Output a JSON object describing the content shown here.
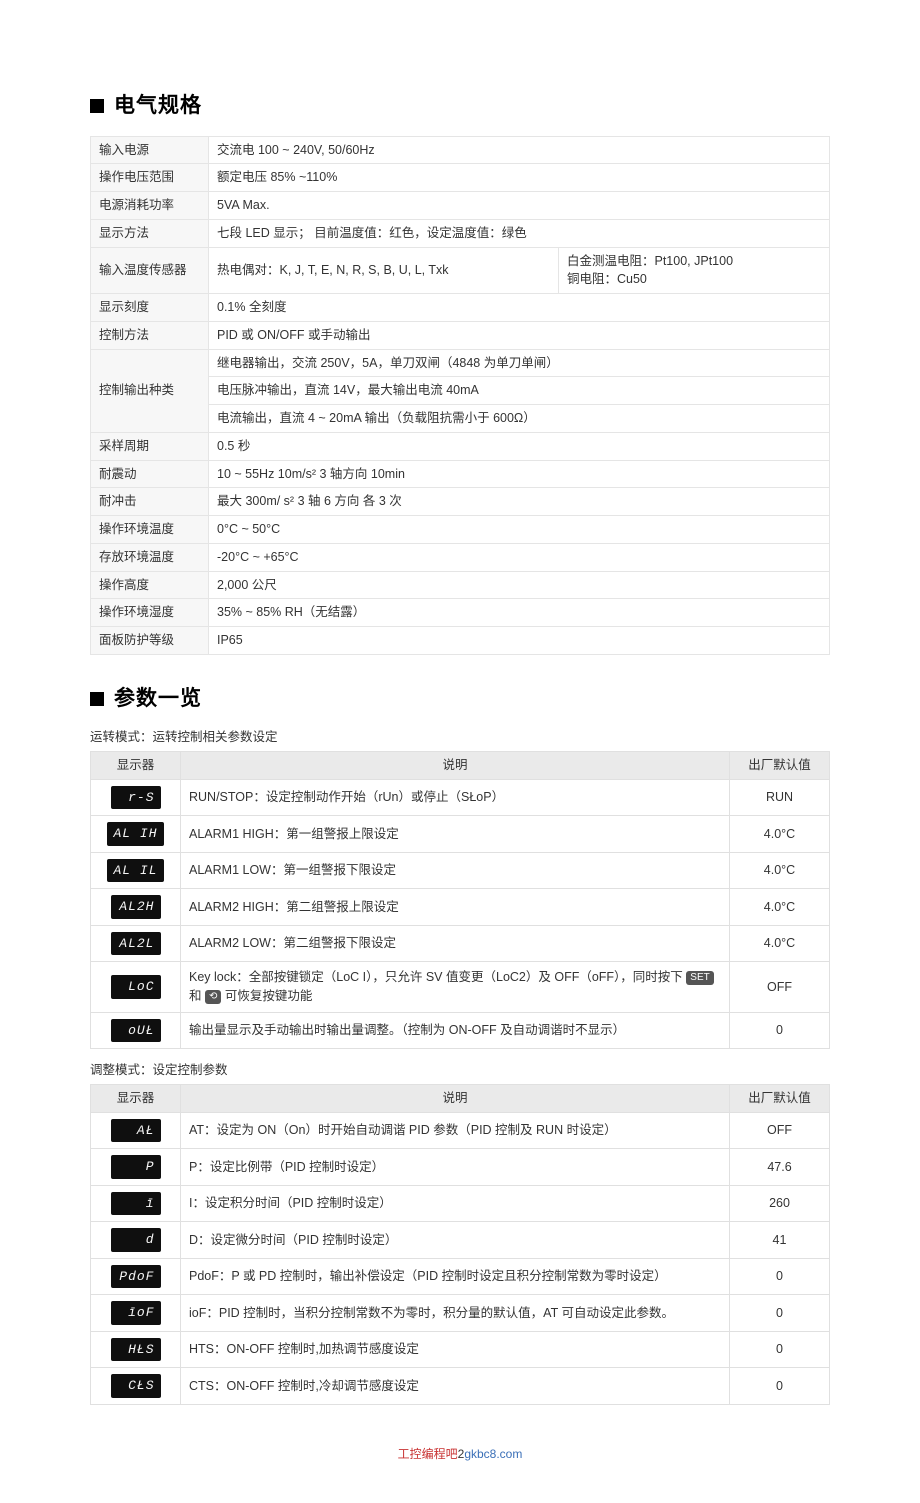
{
  "sections": {
    "electrical": "电气规格",
    "params": "参数一览"
  },
  "spec": {
    "power_supply_label": "输入电源",
    "power_supply": "交流电 100 ~ 240V, 50/60Hz",
    "op_voltage_label": "操作电压范围",
    "op_voltage": "额定电压 85% ~110%",
    "consumption_label": "电源消耗功率",
    "consumption": "5VA Max.",
    "display_method_label": "显示方法",
    "display_method": "七段 LED 显示；  目前温度值：红色，设定温度值：绿色",
    "input_sensor_label": "输入温度传感器",
    "input_sensor_left": "热电偶对：K, J, T, E, N, R, S, B, U, L, Txk",
    "input_sensor_right_a": "白金测温电阻：Pt100, JPt100",
    "input_sensor_right_b": "铜电阻：Cu50",
    "display_scale_label": "显示刻度",
    "display_scale": "0.1%  全刻度",
    "control_method_label": "控制方法",
    "control_method": "PID 或 ON/OFF 或手动输出",
    "ctrl_output_label": "控制输出种类",
    "ctrl_output_1": "继电器输出，交流 250V，5A，单刀双闸（4848 为单刀单闸）",
    "ctrl_output_2": "电压脉冲输出，直流 14V，最大输出电流 40mA",
    "ctrl_output_3": "电流输出，直流 4 ~ 20mA 输出（负载阻抗需小于 600Ω）",
    "sample_label": "采样周期",
    "sample": "0.5 秒",
    "vibration_label": "耐震动",
    "vibration": "10 ~ 55Hz   10m/s²   3 轴方向   10min",
    "shock_label": "耐冲击",
    "shock": "最大 300m/ s²   3 轴 6 方向   各 3 次",
    "op_temp_label": "操作环境温度",
    "op_temp": "0°C ~ 50°C",
    "storage_temp_label": "存放环境温度",
    "storage_temp": "-20°C ~ +65°C",
    "altitude_label": "操作高度",
    "altitude": "2,000 公尺",
    "op_humidity_label": "操作环境湿度",
    "op_humidity": "35% ~ 85% RH（无结露）",
    "ip_label": "面板防护等级",
    "ip": "IP65"
  },
  "run_mode_caption": "运转模式：运转控制相关参数设定",
  "adjust_mode_caption": "调整模式：设定控制参数",
  "param_headers": {
    "display": "显示器",
    "desc": "说明",
    "default": "出厂默认值"
  },
  "run_mode": [
    {
      "seg": "r-S",
      "desc": "RUN/STOP：设定控制动作开始（rUn）或停止（SŁoP）",
      "def": "RUN"
    },
    {
      "seg": "AL IH",
      "desc": "ALARM1 HIGH：第一组警报上限设定",
      "def": "4.0°C"
    },
    {
      "seg": "AL IL",
      "desc": "ALARM1 LOW：第一组警报下限设定",
      "def": "4.0°C"
    },
    {
      "seg": "AL2H",
      "desc": "ALARM2 HIGH：第二组警报上限设定",
      "def": "4.0°C"
    },
    {
      "seg": "AL2L",
      "desc": "ALARM2 LOW：第二组警报下限设定",
      "def": "4.0°C"
    },
    {
      "seg": "LoC",
      "desc_prefix": "Key lock：全部按键锁定（LoC I），只允许 SV 值变更（LoC2）及 OFF（oFF），同时按下 ",
      "desc_mid": " 和 ",
      "desc_suffix": " 可恢复按键功能",
      "def": "OFF"
    },
    {
      "seg": "oUŁ",
      "desc": "输出量显示及手动输出时输出量调整。（控制为 ON-OFF 及自动调谐时不显示）",
      "def": "0"
    }
  ],
  "adjust_mode": [
    {
      "seg": "AŁ",
      "desc": "AT：设定为 ON（On）时开始自动调谐 PID 参数（PID 控制及 RUN 时设定）",
      "def": "OFF"
    },
    {
      "seg": "P",
      "desc": "P：设定比例带（PID 控制时设定）",
      "def": "47.6"
    },
    {
      "seg": "ī",
      "desc": "I：设定积分时间（PID 控制时设定）",
      "def": "260"
    },
    {
      "seg": "d",
      "desc": "D：设定微分时间（PID 控制时设定）",
      "def": "41"
    },
    {
      "seg": "PdoF",
      "desc": "PdoF：P 或 PD 控制时，输出补偿设定（PID 控制时设定且积分控制常数为零时设定）",
      "def": "0"
    },
    {
      "seg": "īoF",
      "desc": "ioF：PID 控制时，当积分控制常数不为零时，积分量的默认值，AT 可自动设定此参数。",
      "def": "0"
    },
    {
      "seg": "HŁS",
      "desc": "HTS：ON-OFF 控制时,加热调节感度设定",
      "def": "0"
    },
    {
      "seg": "CŁS",
      "desc": "CTS：ON-OFF 控制时,冷却调节感度设定",
      "def": "0"
    }
  ],
  "key_set": "SET",
  "key_loop": "⟲",
  "footer": {
    "site_a": "工控编程吧",
    "middle": "2",
    "site_b": "gkbc8.com"
  }
}
